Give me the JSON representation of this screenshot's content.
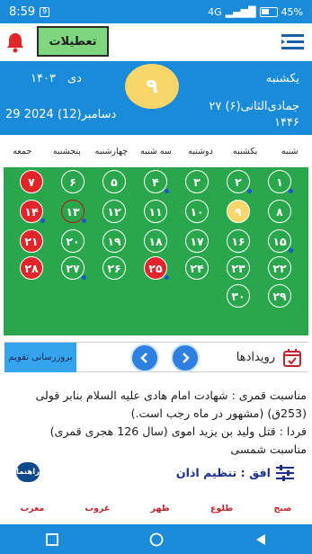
{
  "status_bar": {
    "time": "8:59",
    "network": "4G",
    "battery": "45%"
  },
  "toolbar": {
    "holidays_button": "تعطیلات"
  },
  "header": {
    "day_name": "یکشنبه",
    "day_number": "۹",
    "shamsi_month": "دی",
    "shamsi_year": "۱۴۰۳",
    "hijri_date": "۲۷ جمادی‌الثانی(۶)",
    "hijri_year": "۱۴۴۶",
    "gregorian_date": "29 دسامبر(12) 2024"
  },
  "weekdays": [
    "شنبه",
    "یکشنبه",
    "دوشنبه",
    "سه شنبه",
    "چهارشنبه",
    "پنجشنبه",
    "جمعه"
  ],
  "calendar": {
    "days": [
      {
        "label": "۱",
        "holiday": false,
        "event": true
      },
      {
        "label": "۲",
        "holiday": false,
        "event": true
      },
      {
        "label": "۳",
        "holiday": false,
        "event": false
      },
      {
        "label": "۴",
        "holiday": false,
        "event": true
      },
      {
        "label": "۵",
        "holiday": false,
        "event": false
      },
      {
        "label": "۶",
        "holiday": false,
        "event": false
      },
      {
        "label": "۷",
        "holiday": true,
        "event": false
      },
      {
        "label": "۸",
        "holiday": false,
        "event": false
      },
      {
        "label": "۹",
        "holiday": false,
        "event": false,
        "today": true
      },
      {
        "label": "۱۰",
        "holiday": false,
        "event": false
      },
      {
        "label": "۱۱",
        "holiday": false,
        "event": false
      },
      {
        "label": "۱۲",
        "holiday": false,
        "event": false
      },
      {
        "label": "۱۳",
        "holiday": false,
        "event": true,
        "selected": true
      },
      {
        "label": "۱۴",
        "holiday": true,
        "event": true
      },
      {
        "label": "۱۵",
        "holiday": false,
        "event": true
      },
      {
        "label": "۱۶",
        "holiday": false,
        "event": false
      },
      {
        "label": "۱۷",
        "holiday": false,
        "event": false
      },
      {
        "label": "۱۸",
        "holiday": false,
        "event": false
      },
      {
        "label": "۱۹",
        "holiday": false,
        "event": false
      },
      {
        "label": "۲۰",
        "holiday": false,
        "event": false
      },
      {
        "label": "۲۱",
        "holiday": true,
        "event": false
      },
      {
        "label": "۲۲",
        "holiday": false,
        "event": false
      },
      {
        "label": "۲۳",
        "holiday": false,
        "event": false
      },
      {
        "label": "۲۴",
        "holiday": false,
        "event": false
      },
      {
        "label": "۲۵",
        "holiday": true,
        "event": true
      },
      {
        "label": "۲۶",
        "holiday": false,
        "event": false
      },
      {
        "label": "۲۷",
        "holiday": false,
        "event": true
      },
      {
        "label": "۲۸",
        "holiday": true,
        "event": false
      },
      {
        "label": "۲۹",
        "holiday": false,
        "event": false
      },
      {
        "label": "۳۰",
        "holiday": false,
        "event": false
      }
    ]
  },
  "events_bar": {
    "title": "رویدادها",
    "update_button": "بروزرسانی تقویم"
  },
  "events": {
    "line1": "مناسبت قمری : شهادت امام هادی علیه السلام بنابر قولی (253ق) (مشهور در ماه رجب است.)",
    "line2": "فردا : قتل ولید بن یزید اموی (سال 126 هجری قمری)",
    "line3": "مناسبت شمسی"
  },
  "azan": {
    "label": "افق : تنظیم اذان",
    "guide_button": "راهنما"
  },
  "prayers": [
    "صبح",
    "طلوع",
    "ظهر",
    "غروب",
    "مغرب"
  ],
  "colors": {
    "primary": "#1a8bd9",
    "grid_green": "#2aa64c",
    "holiday_red": "#e0252b",
    "today_yellow": "#f9d66a",
    "event_dot": "#1857c9",
    "prayer_red": "#c0242c"
  },
  "icons": {
    "bell": "bell-icon",
    "menu": "menu-icon",
    "calendar": "calendar-icon",
    "sliders": "sliders-icon",
    "nav": [
      "triangle-back-icon",
      "circle-home-icon",
      "square-recent-icon"
    ]
  }
}
